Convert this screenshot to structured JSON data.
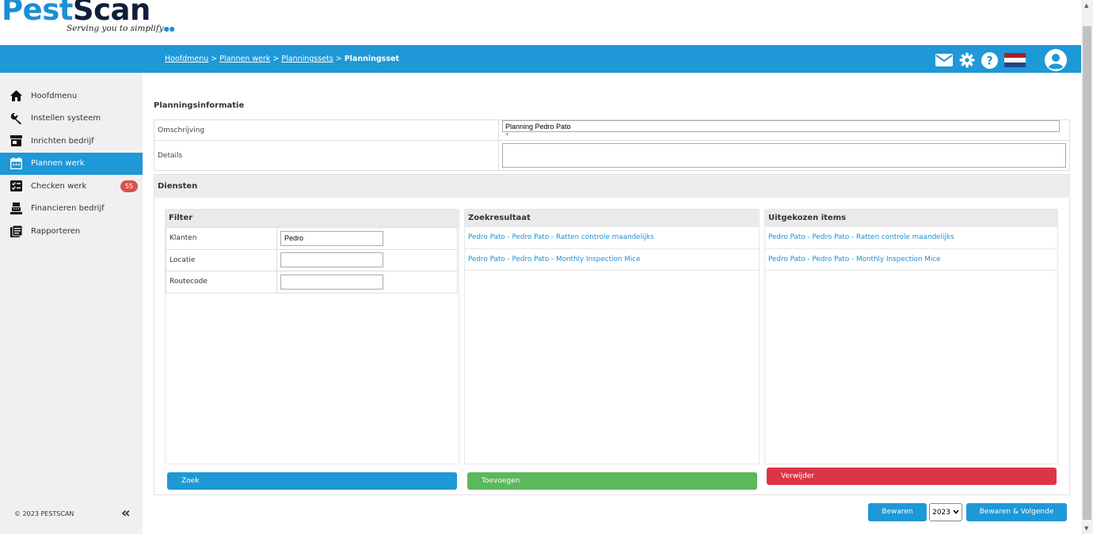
{
  "logo": {
    "part1": "Pest",
    "part2": "Scan",
    "tagline": "Serving you to simplify"
  },
  "breadcrumb": {
    "items": [
      "Hoofdmenu",
      "Plannen werk",
      "Planningssets"
    ],
    "current": "Planningsset",
    "separator": ">"
  },
  "top_icons": [
    "mail-icon",
    "gear-icon",
    "help-icon",
    "flag-nl-icon",
    "user-avatar-icon"
  ],
  "sidebar": {
    "items": [
      {
        "label": "Hoofdmenu",
        "icon": "home-icon"
      },
      {
        "label": "Instellen systeem",
        "icon": "wrench-icon"
      },
      {
        "label": "Inrichten bedrijf",
        "icon": "store-icon"
      },
      {
        "label": "Plannen werk",
        "icon": "calendar-icon",
        "active": true
      },
      {
        "label": "Checken werk",
        "icon": "checklist-icon",
        "badge": "55"
      },
      {
        "label": "Financieren bedrijf",
        "icon": "cash-register-icon"
      },
      {
        "label": "Rapporteren",
        "icon": "report-icon"
      }
    ],
    "copyright": "© 2023 PESTSCAN",
    "collapse": "«"
  },
  "planning": {
    "title": "Planningsinformatie",
    "omschrijving_label": "Omschrijving",
    "omschrijving_value": "Planning Pedro Pato",
    "required_mark": "*",
    "details_label": "Details"
  },
  "diensten": {
    "title": "Diensten",
    "filter": {
      "title": "Filter",
      "rows": [
        {
          "label": "Klanten",
          "value": "Pedro"
        },
        {
          "label": "Locatie",
          "value": ""
        },
        {
          "label": "Routecode",
          "value": ""
        }
      ]
    },
    "zoekresultaat": {
      "title": "Zoekresultaat",
      "items": [
        "Pedro Pato - Pedro Pato - Ratten controle maandelijks",
        "Pedro Pato - Pedro Pato - Monthly Inspection Mice"
      ]
    },
    "uitgekozen": {
      "title": "Uitgekozen items",
      "items": [
        "Pedro Pato - Pedro Pato - Ratten controle maandelijks",
        "Pedro Pato - Pedro Pato - Monthly Inspection Mice"
      ]
    },
    "buttons": {
      "zoek": "Zoek",
      "toevoegen": "Toevoegen",
      "verwijder": "Verwijder"
    }
  },
  "footer": {
    "bewaren": "Bewaren",
    "year": "2023",
    "bewaren_volgende": "Bewaren & Volgende"
  },
  "colors": {
    "brand_blue": "#1e98d7",
    "green": "#5cb85c",
    "red": "#dc3545",
    "badge": "#d9534f"
  }
}
